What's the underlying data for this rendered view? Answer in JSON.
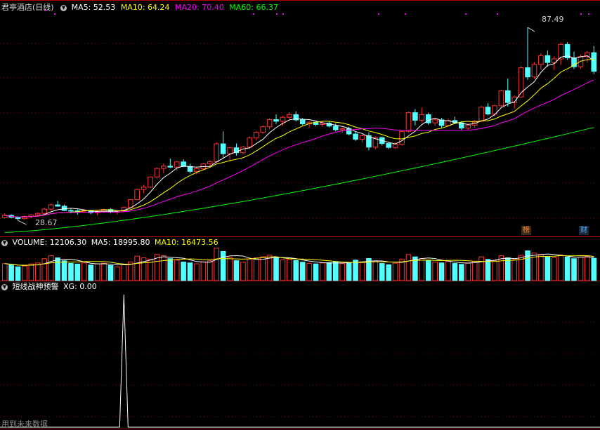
{
  "header": {
    "stock_name": "君亭酒店(日线)",
    "ma5": "MA5: 52.53",
    "ma10": "MA10: 64.24",
    "ma20": "MA20: 70.40",
    "ma60": "MA60: 66.37"
  },
  "volume_header": {
    "volume": "VOLUME: 12106.30",
    "ma5": "MA5: 18995.80",
    "ma10": "MA10: 16473.56"
  },
  "indicator_header": {
    "name": "短线战神预警",
    "xg": "XG: 0.00"
  },
  "annotations": {
    "high_label": "87.49",
    "low_label": "28.67",
    "tag_bang": "榜",
    "tag_cai": "财"
  },
  "watermark": "用到未来数据",
  "colors": {
    "up": "#ff3232",
    "down": "#54ffff",
    "ma5": "#ffffff",
    "ma10": "#ffff00",
    "ma20": "#ff00ff",
    "ma60": "#00ff00",
    "grid": "#8b0000"
  },
  "chart_data": {
    "type": "candlestick",
    "price_range": [
      24,
      92
    ],
    "high": 87.49,
    "low": 28.67,
    "ohlc": [
      [
        29.5,
        30.8,
        29.2,
        30.2
      ],
      [
        30.2,
        30.5,
        29.3,
        29.6
      ],
      [
        29.6,
        29.9,
        28.67,
        29.2
      ],
      [
        29.2,
        30.1,
        29.0,
        29.9
      ],
      [
        29.9,
        30.6,
        29.4,
        30.3
      ],
      [
        30.3,
        31.1,
        29.9,
        30.8
      ],
      [
        30.8,
        32.5,
        30.6,
        32.1
      ],
      [
        32.1,
        33.8,
        31.7,
        33.4
      ],
      [
        33.4,
        34.6,
        32.8,
        33.0
      ],
      [
        33.0,
        33.5,
        31.5,
        31.7
      ],
      [
        31.7,
        32.2,
        30.8,
        31.6
      ],
      [
        31.6,
        32.0,
        30.4,
        31.3
      ],
      [
        31.3,
        32.1,
        30.9,
        31.7
      ],
      [
        31.7,
        31.9,
        30.6,
        31.0
      ],
      [
        31.0,
        31.8,
        30.2,
        31.4
      ],
      [
        31.4,
        32.3,
        31.0,
        32.0
      ],
      [
        32.0,
        32.4,
        30.8,
        31.2
      ],
      [
        31.2,
        31.8,
        30.5,
        31.5
      ],
      [
        31.5,
        32.9,
        31.3,
        32.6
      ],
      [
        32.6,
        35.2,
        32.3,
        35.0
      ],
      [
        35.0,
        38.3,
        34.8,
        38.1
      ],
      [
        38.1,
        39.5,
        37.0,
        38.8
      ],
      [
        38.8,
        42.1,
        38.5,
        41.9
      ],
      [
        41.9,
        44.8,
        41.4,
        44.5
      ],
      [
        44.5,
        46.0,
        43.1,
        45.2
      ],
      [
        45.2,
        47.5,
        44.6,
        44.9
      ],
      [
        44.9,
        46.8,
        43.8,
        46.5
      ],
      [
        46.5,
        47.3,
        44.9,
        45.1
      ],
      [
        45.1,
        45.9,
        43.0,
        43.6
      ],
      [
        43.6,
        44.8,
        42.7,
        44.4
      ],
      [
        44.4,
        46.2,
        44.0,
        45.9
      ],
      [
        45.9,
        47.0,
        45.0,
        46.6
      ],
      [
        46.6,
        52.5,
        46.3,
        52.0
      ],
      [
        52.0,
        55.8,
        47.8,
        49.0
      ],
      [
        49.0,
        51.0,
        46.6,
        50.8
      ],
      [
        50.8,
        52.1,
        48.4,
        49.3
      ],
      [
        49.3,
        51.4,
        48.8,
        51.0
      ],
      [
        51.0,
        54.2,
        50.4,
        53.8
      ],
      [
        53.8,
        55.9,
        53.0,
        55.5
      ],
      [
        55.5,
        57.6,
        55.1,
        57.2
      ],
      [
        57.2,
        59.8,
        56.4,
        59.4
      ],
      [
        59.4,
        61.0,
        58.0,
        58.9
      ],
      [
        58.9,
        60.5,
        57.5,
        60.1
      ],
      [
        60.1,
        61.7,
        59.0,
        60.9
      ],
      [
        60.9,
        61.9,
        58.8,
        59.3
      ],
      [
        59.3,
        59.9,
        57.6,
        58.1
      ],
      [
        58.1,
        58.9,
        57.0,
        58.6
      ],
      [
        58.6,
        59.1,
        57.4,
        57.9
      ],
      [
        57.9,
        58.8,
        57.2,
        58.3
      ],
      [
        58.3,
        58.8,
        57.0,
        57.4
      ],
      [
        57.4,
        58.2,
        55.8,
        56.3
      ],
      [
        56.3,
        57.0,
        55.4,
        56.6
      ],
      [
        56.6,
        57.2,
        54.6,
        55.0
      ],
      [
        55.0,
        55.7,
        52.9,
        53.4
      ],
      [
        53.4,
        54.9,
        52.5,
        54.5
      ],
      [
        54.5,
        55.5,
        50.0,
        51.0
      ],
      [
        51.0,
        54.3,
        50.4,
        53.9
      ],
      [
        53.9,
        54.2,
        51.5,
        52.1
      ],
      [
        52.1,
        52.6,
        50.4,
        50.9
      ],
      [
        50.9,
        52.4,
        50.5,
        51.9
      ],
      [
        51.9,
        56.1,
        51.5,
        55.8
      ],
      [
        55.8,
        61.9,
        55.4,
        61.5
      ],
      [
        61.5,
        62.6,
        57.6,
        59.2
      ],
      [
        59.2,
        63.0,
        58.6,
        60.9
      ],
      [
        60.9,
        61.5,
        57.8,
        58.4
      ],
      [
        58.4,
        59.8,
        57.5,
        59.3
      ],
      [
        59.3,
        59.9,
        56.9,
        57.6
      ],
      [
        57.6,
        59.6,
        57.2,
        59.1
      ],
      [
        59.1,
        60.3,
        58.0,
        58.4
      ],
      [
        58.4,
        58.9,
        56.2,
        56.8
      ],
      [
        56.8,
        58.1,
        56.3,
        57.7
      ],
      [
        57.7,
        59.3,
        56.9,
        58.9
      ],
      [
        58.9,
        63.5,
        58.6,
        63.2
      ],
      [
        63.2,
        64.4,
        60.7,
        61.1
      ],
      [
        61.1,
        63.9,
        60.4,
        63.6
      ],
      [
        63.6,
        68.5,
        63.1,
        68.2
      ],
      [
        68.2,
        71.9,
        63.4,
        64.6
      ],
      [
        64.6,
        66.7,
        62.7,
        66.3
      ],
      [
        66.3,
        75.8,
        66.0,
        75.2
      ],
      [
        75.2,
        87.49,
        71.5,
        72.4
      ],
      [
        72.4,
        76.9,
        71.8,
        76.2
      ],
      [
        76.2,
        79.6,
        74.5,
        78.9
      ],
      [
        78.9,
        80.5,
        75.5,
        76.8
      ],
      [
        76.8,
        78.6,
        74.4,
        77.9
      ],
      [
        77.9,
        82.9,
        76.1,
        82.3
      ],
      [
        82.3,
        83.0,
        77.6,
        78.2
      ],
      [
        78.2,
        80.1,
        74.8,
        75.5
      ],
      [
        75.5,
        79.2,
        74.9,
        78.6
      ],
      [
        78.6,
        80.3,
        76.8,
        79.8
      ],
      [
        79.8,
        81.8,
        73.2,
        74.1
      ]
    ],
    "volume_range": [
      0,
      24000
    ],
    "volume": [
      12106,
      11200,
      9800,
      10400,
      11900,
      12600,
      15600,
      17800,
      16200,
      14100,
      12300,
      11800,
      12700,
      11100,
      11900,
      12400,
      10800,
      9700,
      11300,
      13200,
      17400,
      16200,
      15100,
      18600,
      17700,
      15600,
      14600,
      13200,
      12600,
      12000,
      13400,
      14100,
      23100,
      20800,
      16400,
      14200,
      13100,
      15400,
      16200,
      17000,
      18200,
      16000,
      14800,
      15100,
      14300,
      13100,
      12300,
      11900,
      12600,
      12800,
      13500,
      12100,
      12900,
      14600,
      13400,
      15800,
      13900,
      12200,
      11300,
      12400,
      15100,
      18500,
      16900,
      15700,
      14300,
      13200,
      12600,
      13800,
      12200,
      11600,
      12400,
      13900,
      16900,
      15100,
      14300,
      17700,
      16200,
      14900,
      18000,
      21200,
      19600,
      18700,
      17100,
      16300,
      18200,
      16800,
      15600,
      16900,
      17400,
      15900
    ],
    "series": [
      {
        "name": "MA5",
        "color": "#ffffff"
      },
      {
        "name": "MA10",
        "color": "#ffff00"
      },
      {
        "name": "MA20",
        "color": "#ff00ff"
      },
      {
        "name": "MA60",
        "color": "#00ff00"
      }
    ],
    "ma60_start": 25.0,
    "ma60_end": 57.0,
    "xg_signal_index": 18,
    "xg_max": 1
  }
}
